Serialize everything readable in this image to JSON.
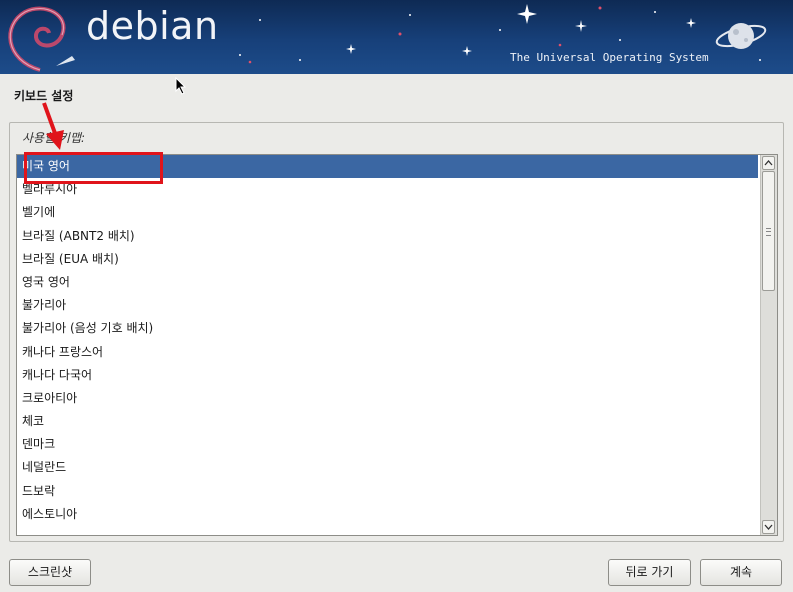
{
  "banner": {
    "logo_text": "debian",
    "tagline": "The Universal Operating System"
  },
  "page": {
    "title": "키보드 설정",
    "list_label": "사용할 키맵:"
  },
  "keymap_list": {
    "selected_index": 0,
    "items": [
      "미국 영어",
      "벨라루시아",
      "벨기에",
      "브라질 (ABNT2 배치)",
      "브라질 (EUA 배치)",
      "영국 영어",
      "불가리아",
      "불가리아 (음성 기호 배치)",
      "캐나다 프랑스어",
      "캐나다 다국어",
      "크로아티아",
      "체코",
      "덴마크",
      "네덜란드",
      "드보락",
      "에스토니아"
    ]
  },
  "buttons": {
    "screenshot": "스크린샷",
    "back": "뒤로 가기",
    "continue": "계속"
  },
  "colors": {
    "selection": "#3b67a3",
    "annotation": "#e0141b",
    "banner": "#17407a"
  }
}
